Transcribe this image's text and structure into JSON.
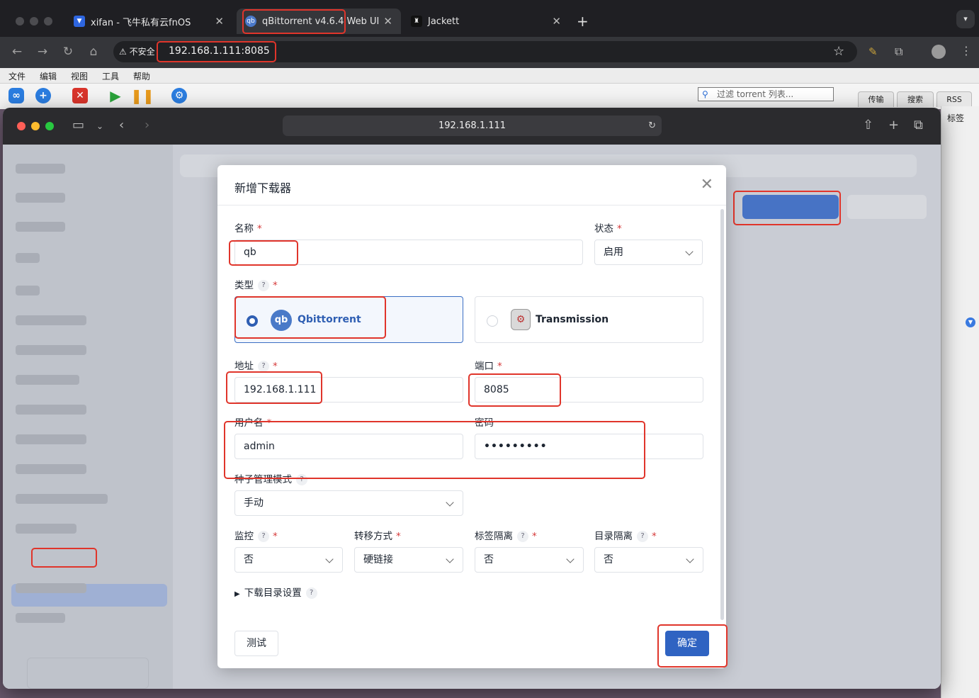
{
  "chrome": {
    "tabs": [
      {
        "title": "xifan - 飞牛私有云fnOS",
        "icon": "fnos-icon"
      },
      {
        "title": "qBittorrent v4.6.4 Web UI",
        "icon": "qbittorrent-icon"
      },
      {
        "title": "Jackett",
        "icon": "jackett-icon"
      }
    ],
    "insecure_label": "不安全",
    "url": "192.168.1.111:8085"
  },
  "qb": {
    "menu": [
      "文件",
      "编辑",
      "视图",
      "工具",
      "帮助"
    ],
    "filter_placeholder": "过滤 torrent 列表...",
    "tabs": [
      "传输",
      "搜索",
      "RSS"
    ],
    "side_label": "标签"
  },
  "safari": {
    "url": "192.168.1.111"
  },
  "modal": {
    "title": "新增下载器",
    "name_label": "名称",
    "name_value": "qb",
    "status_label": "状态",
    "status_value": "启用",
    "type_label": "类型",
    "types": [
      {
        "name": "Qbittorrent",
        "selected": true
      },
      {
        "name": "Transmission",
        "selected": false
      }
    ],
    "address_label": "地址",
    "address_value": "192.168.1.111",
    "port_label": "端口",
    "port_value": "8085",
    "username_label": "用户名",
    "username_value": "admin",
    "password_label": "密码",
    "password_value": "•••••••••",
    "torrent_mode_label": "种子管理模式",
    "torrent_mode_value": "手动",
    "monitor_label": "监控",
    "monitor_value": "否",
    "transfer_label": "转移方式",
    "transfer_value": "硬链接",
    "tag_isolation_label": "标签隔离",
    "tag_isolation_value": "否",
    "dir_isolation_label": "目录隔离",
    "dir_isolation_value": "否",
    "download_dir_label": "下载目录设置",
    "test_button": "测试",
    "confirm_button": "确定",
    "required_mark": "*",
    "help_mark": "?"
  }
}
